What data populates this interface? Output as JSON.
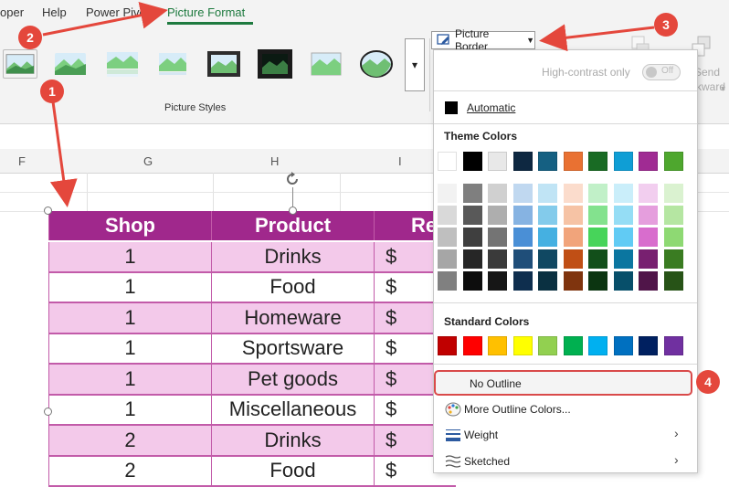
{
  "ribbon": {
    "tabs": [
      {
        "label": "oper"
      },
      {
        "label": "Help"
      },
      {
        "label": "Power Pivo"
      },
      {
        "label": "Picture Format"
      }
    ],
    "picture_styles_label": "Picture Styles",
    "picture_border_label": "Picture Border",
    "send_backward_label_1": "Send",
    "send_backward_label_2": "ckward"
  },
  "grid": {
    "columns": [
      "F",
      "G",
      "H",
      "I"
    ]
  },
  "table": {
    "headers": [
      "Shop",
      "Product",
      "Re"
    ],
    "rows": [
      {
        "shop": "1",
        "product": "Drinks",
        "cur": "$"
      },
      {
        "shop": "1",
        "product": "Food",
        "cur": "$"
      },
      {
        "shop": "1",
        "product": "Homeware",
        "cur": "$"
      },
      {
        "shop": "1",
        "product": "Sportsware",
        "cur": "$"
      },
      {
        "shop": "1",
        "product": "Pet goods",
        "cur": "$"
      },
      {
        "shop": "1",
        "product": "Miscellaneous",
        "cur": "$"
      },
      {
        "shop": "2",
        "product": "Drinks",
        "cur": "$"
      },
      {
        "shop": "2",
        "product": "Food",
        "cur": "$"
      }
    ]
  },
  "menu": {
    "high_contrast_label": "High-contrast only",
    "toggle_state": "Off",
    "automatic_label": "Automatic",
    "theme_colors_label": "Theme Colors",
    "standard_colors_label": "Standard Colors",
    "no_outline_label": "No Outline",
    "more_colors_label": "More Outline Colors...",
    "weight_label": "Weight",
    "sketched_label": "Sketched"
  },
  "colors": {
    "accent": "#1e7a3f",
    "table_header": "#a0288c",
    "table_band": "#f3c9ea",
    "annotation": "#e4473c",
    "theme_top": [
      "#ffffff",
      "#000000",
      "#e8e8e8",
      "#0e2841",
      "#156082",
      "#e97132",
      "#196b24",
      "#0f9ed5",
      "#a02b93",
      "#4ea72e"
    ],
    "theme_shades": [
      [
        "#f2f2f2",
        "#7f7f7f",
        "#d0d0d0",
        "#c0d8f0",
        "#c0e4f5",
        "#fbdccc",
        "#c1f0c8",
        "#caeefa",
        "#f2ceef",
        "#daf2d0"
      ],
      [
        "#d9d9d9",
        "#595959",
        "#aeaeae",
        "#86b3e2",
        "#83cbeb",
        "#f6c3a5",
        "#83e28e",
        "#95ddf5",
        "#e59edd",
        "#b5e6a2"
      ],
      [
        "#bfbfbf",
        "#3f3f3f",
        "#747474",
        "#4a8fd6",
        "#45b0e1",
        "#f1a47b",
        "#47d45a",
        "#61cbf4",
        "#d86dcd",
        "#8ed973"
      ],
      [
        "#a6a6a6",
        "#262626",
        "#3a3a3a",
        "#1f4e79",
        "#104862",
        "#c04f15",
        "#124f1a",
        "#0b76a0",
        "#782070",
        "#3a7c22"
      ],
      [
        "#808080",
        "#0d0d0d",
        "#161616",
        "#0e2e4e",
        "#0a3041",
        "#7f340e",
        "#0c3511",
        "#074f6a",
        "#501549",
        "#275317"
      ]
    ],
    "standard": [
      "#c00000",
      "#ff0000",
      "#ffc000",
      "#ffff00",
      "#92d050",
      "#00b050",
      "#00b0f0",
      "#0070c0",
      "#002060",
      "#7030a0"
    ]
  },
  "annotations": [
    "1",
    "2",
    "3",
    "4"
  ]
}
